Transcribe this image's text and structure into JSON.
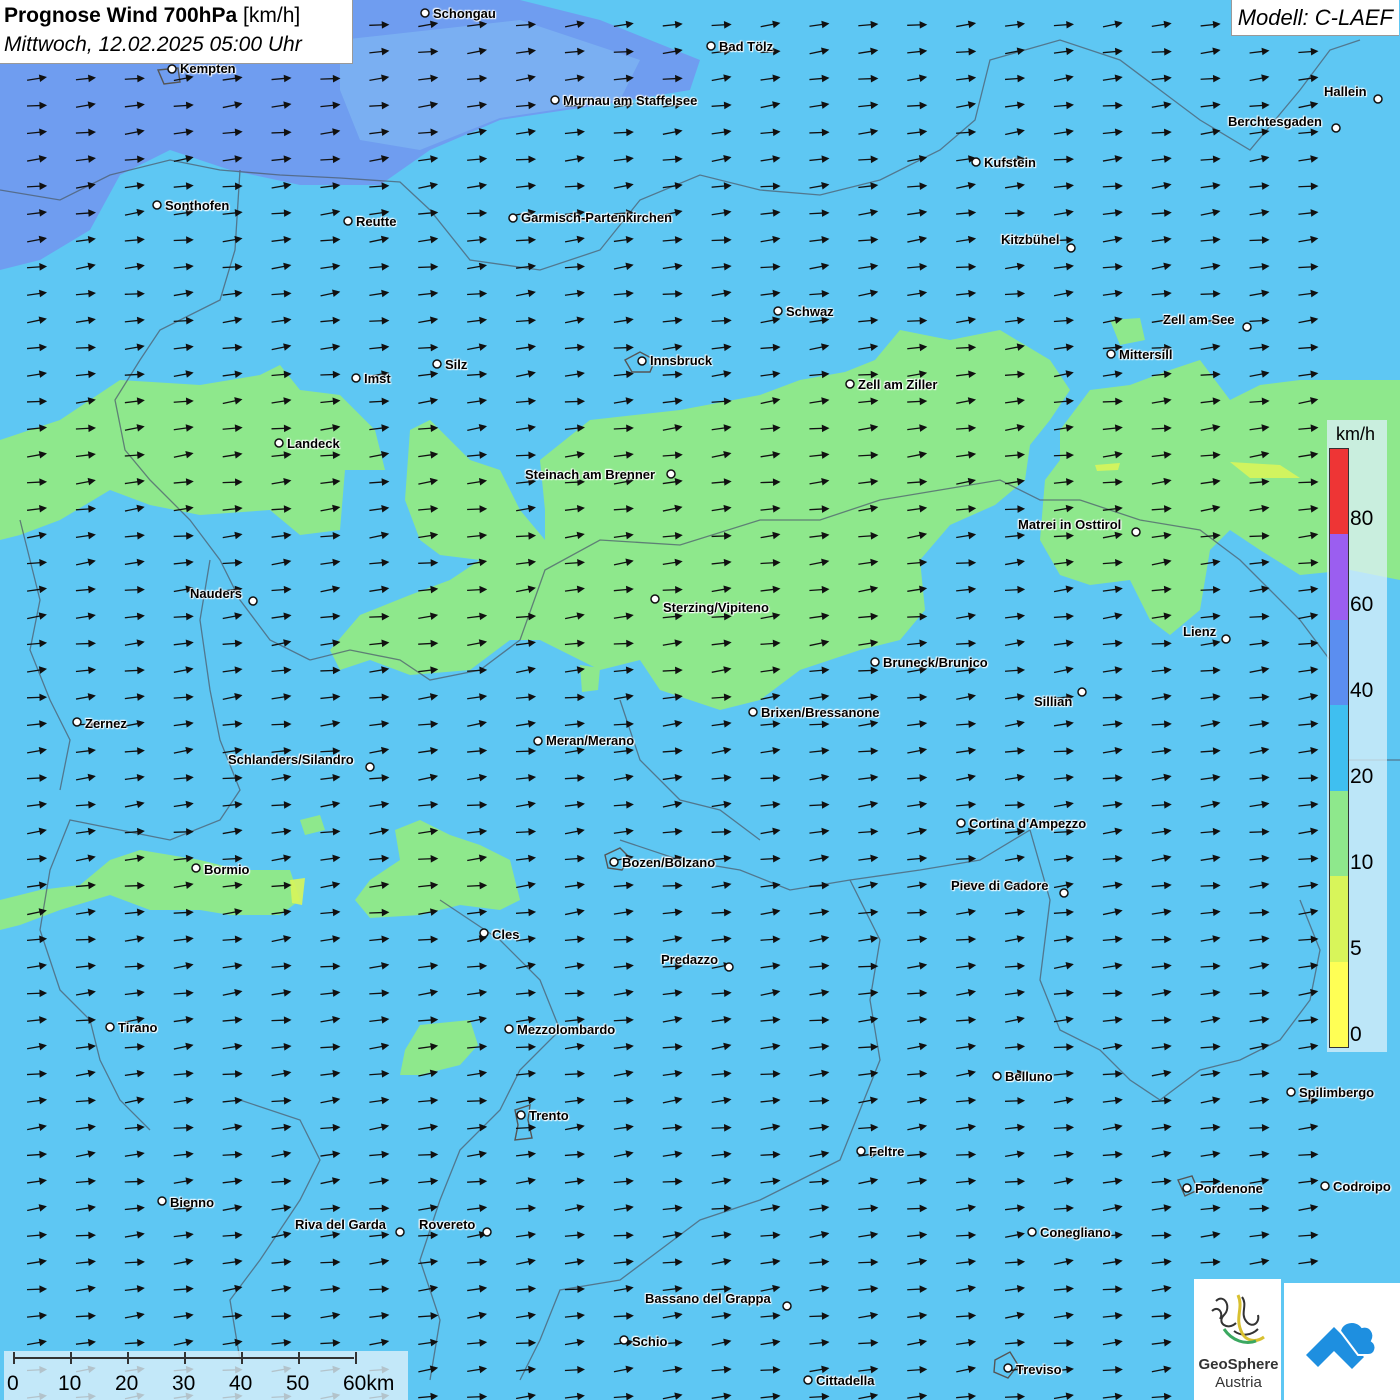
{
  "title": {
    "parameter": "Prognose Wind 700hPa",
    "unit": "[km/h]",
    "valid_time": "Mittwoch, 12.02.2025 05:00 Uhr"
  },
  "model": "Modell: C-LAEF",
  "legend": {
    "unit": "km/h",
    "ticks": [
      "80",
      "60",
      "40",
      "20",
      "10",
      "5",
      "0"
    ],
    "colors": [
      "#ffff55",
      "#d8f55a",
      "#8ee88c",
      "#3fbff0",
      "#5b8ef0",
      "#9b5ef0",
      "#ee3535"
    ]
  },
  "scale_bar": {
    "labels": [
      "0",
      "10",
      "20",
      "30",
      "40",
      "50",
      "60km"
    ]
  },
  "logo": {
    "name": "GeoSphere",
    "country": "Austria"
  },
  "cities": [
    {
      "name": "Schongau"
    },
    {
      "name": "Bad Tölz"
    },
    {
      "name": "Kempten"
    },
    {
      "name": "Murnau am Staffelsee"
    },
    {
      "name": "Hallein"
    },
    {
      "name": "Berchtesgaden"
    },
    {
      "name": "Kufstein"
    },
    {
      "name": "Sonthofen"
    },
    {
      "name": "Reutte"
    },
    {
      "name": "Garmisch-Partenkirchen"
    },
    {
      "name": "Kitzbühel"
    },
    {
      "name": "Schwaz"
    },
    {
      "name": "Zell am See"
    },
    {
      "name": "Mittersill"
    },
    {
      "name": "Innsbruck"
    },
    {
      "name": "Silz"
    },
    {
      "name": "Imst"
    },
    {
      "name": "Zell am Ziller"
    },
    {
      "name": "Landeck"
    },
    {
      "name": "Steinach am Brenner"
    },
    {
      "name": "Matrei in Osttirol"
    },
    {
      "name": "Nauders"
    },
    {
      "name": "Sterzing/Vipiteno"
    },
    {
      "name": "Lienz"
    },
    {
      "name": "Bruneck/Brunico"
    },
    {
      "name": "Sillian"
    },
    {
      "name": "Brixen/Bressanone"
    },
    {
      "name": "Zernez"
    },
    {
      "name": "Meran/Merano"
    },
    {
      "name": "Schlanders/Silandro"
    },
    {
      "name": "Cortina d'Ampezzo"
    },
    {
      "name": "Bozen/Bolzano"
    },
    {
      "name": "Bormio"
    },
    {
      "name": "Pieve di Cadore"
    },
    {
      "name": "Cles"
    },
    {
      "name": "Predazzo"
    },
    {
      "name": "Tirano"
    },
    {
      "name": "Mezzolombardo"
    },
    {
      "name": "Belluno"
    },
    {
      "name": "Spilimbergo"
    },
    {
      "name": "Trento"
    },
    {
      "name": "Feltre"
    },
    {
      "name": "Pordenone"
    },
    {
      "name": "Codroipo"
    },
    {
      "name": "Bienno"
    },
    {
      "name": "Riva del Garda"
    },
    {
      "name": "Rovereto"
    },
    {
      "name": "Conegliano"
    },
    {
      "name": "Bassano del Grappa"
    },
    {
      "name": "Schio"
    },
    {
      "name": "Treviso"
    },
    {
      "name": "Cittadella"
    }
  ]
}
